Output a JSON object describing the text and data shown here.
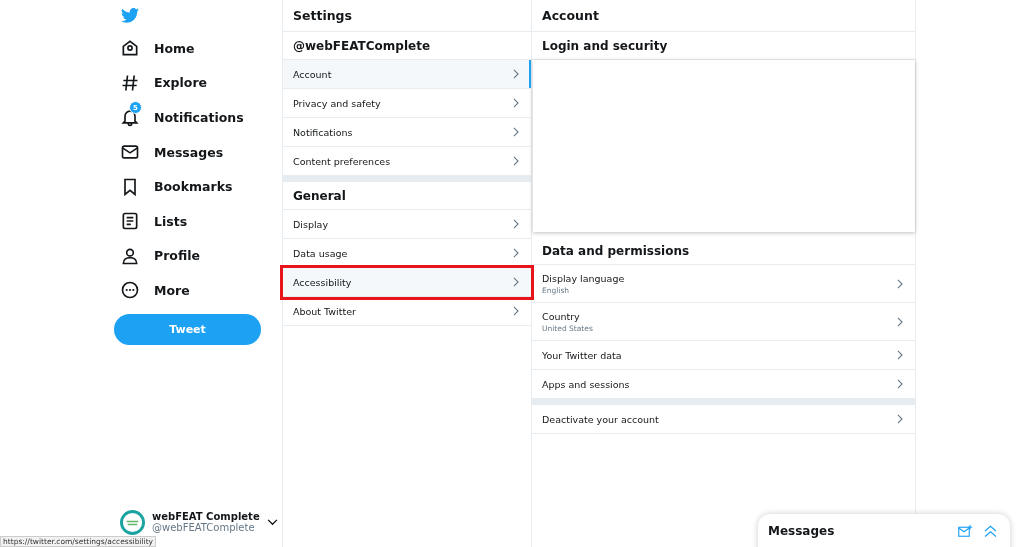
{
  "nav": {
    "items": [
      {
        "label": "Home"
      },
      {
        "label": "Explore"
      },
      {
        "label": "Notifications",
        "badge": "5"
      },
      {
        "label": "Messages"
      },
      {
        "label": "Bookmarks"
      },
      {
        "label": "Lists"
      },
      {
        "label": "Profile"
      },
      {
        "label": "More"
      }
    ],
    "tweet_button": "Tweet",
    "account": {
      "name": "webFEAT Complete",
      "handle": "@webFEATComplete"
    }
  },
  "settings": {
    "title": "Settings",
    "sections": [
      {
        "heading": "@webFEATComplete",
        "items": [
          {
            "label": "Account",
            "selected": true,
            "highlighted": false
          },
          {
            "label": "Privacy and safety",
            "selected": false,
            "highlighted": false
          },
          {
            "label": "Notifications",
            "selected": false,
            "highlighted": false
          },
          {
            "label": "Content preferences",
            "selected": false,
            "highlighted": false
          }
        ]
      },
      {
        "heading": "General",
        "items": [
          {
            "label": "Display",
            "selected": false,
            "highlighted": false
          },
          {
            "label": "Data usage",
            "selected": false,
            "highlighted": false
          },
          {
            "label": "Accessibility",
            "selected": false,
            "highlighted": true
          },
          {
            "label": "About Twitter",
            "selected": false,
            "highlighted": false
          }
        ]
      }
    ]
  },
  "account": {
    "title": "Account",
    "login_heading": "Login and security",
    "data_heading": "Data and permissions",
    "items": [
      {
        "label": "Display language",
        "value": "English"
      },
      {
        "label": "Country",
        "value": "United States"
      },
      {
        "label": "Your Twitter data"
      },
      {
        "label": "Apps and sessions"
      }
    ],
    "deactivate": "Deactivate your account"
  },
  "messages_dock": {
    "title": "Messages"
  },
  "status_bar": {
    "url": "https://twitter.com/settings/accessibility"
  }
}
